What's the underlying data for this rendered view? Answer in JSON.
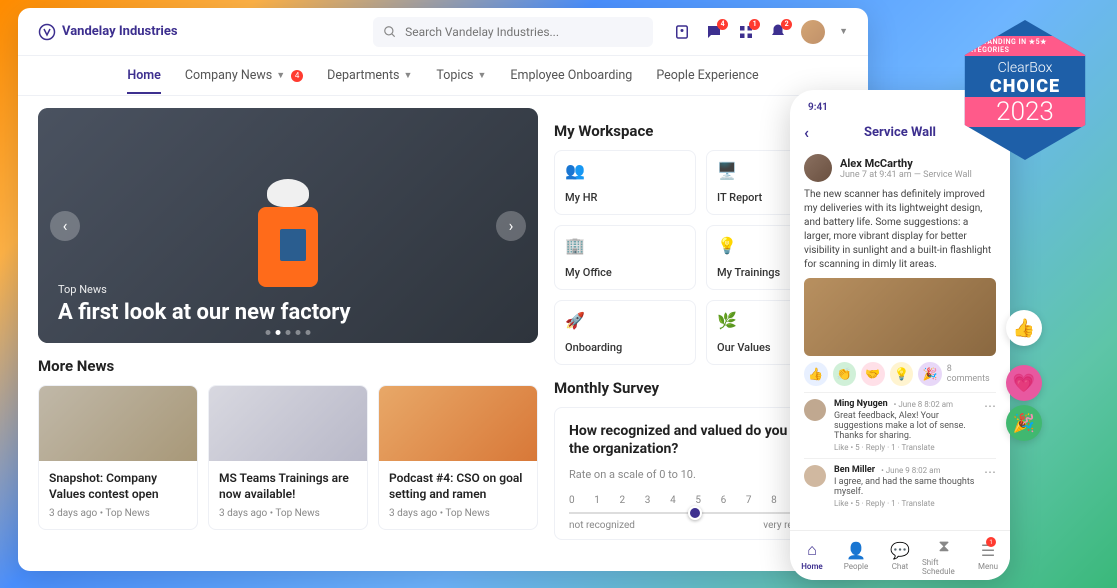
{
  "brand": "Vandelay Industries",
  "search": {
    "placeholder": "Search Vandelay Industries..."
  },
  "topIcons": {
    "chat_badge": "4",
    "apps_badge": "1",
    "bell_badge": "2"
  },
  "nav": {
    "home": "Home",
    "company_news": "Company News",
    "company_news_badge": "4",
    "departments": "Departments",
    "topics": "Topics",
    "onboarding": "Employee Onboarding",
    "people": "People Experience"
  },
  "hero": {
    "tag": "Top News",
    "title": "A first look at our new factory"
  },
  "more_news_heading": "More News",
  "news": [
    {
      "title": "Snapshot: Company Values contest open",
      "meta": "3 days ago • Top News"
    },
    {
      "title": "MS Teams Trainings are now available!",
      "meta": "3 days ago • Top News"
    },
    {
      "title": "Podcast #4: CSO on goal setting and ramen",
      "meta": "3 days ago • Top News"
    }
  ],
  "workspace": {
    "heading": "My Workspace",
    "tiles": [
      "My HR",
      "IT Report",
      "My Office",
      "My Trainings",
      "Onboarding",
      "Our Values"
    ]
  },
  "survey": {
    "heading": "Monthly Survey",
    "question": "How recognized and valued do you feel in the organization?",
    "hint": "Rate on a scale of 0 to 10.",
    "min_label": "not recognized",
    "max_label": "very recognized"
  },
  "phone": {
    "time": "9:41",
    "header": "Service Wall",
    "post_author": "Alex McCarthy",
    "post_meta": "June 7 at 9:41 am — Service Wall",
    "post_text": "The new scanner has definitely improved my deliveries with its lightweight design, and battery life. Some suggestions: a larger, more vibrant display for better visibility in sunlight and a built-in flashlight for scanning in dimly lit areas.",
    "comments_count": "8 comments",
    "c1_author": "Ming Nyugen",
    "c1_time": "• June 8 8:02 am",
    "c1_text": "Great feedback, Alex! Your suggestions make a lot of sense. Thanks for sharing.",
    "c1_actions": "Like • 5 · Reply · 1 · Translate",
    "c2_author": "Ben Miller",
    "c2_time": "• June 9 8:02 am",
    "c2_text": "I agree, and had the same thoughts myself.",
    "c2_actions": "Like • 5 · Reply · 1 · Translate",
    "nav": [
      "Home",
      "People",
      "Chat",
      "Shift Schedule",
      "Menu"
    ],
    "menu_badge": "1"
  },
  "award": {
    "ribbon_left": "OUTSTANDING IN",
    "ribbon_num": "5",
    "ribbon_right": "CATEGORIES",
    "brand": "ClearBox",
    "choice": "CHOICE",
    "year": "2023"
  }
}
